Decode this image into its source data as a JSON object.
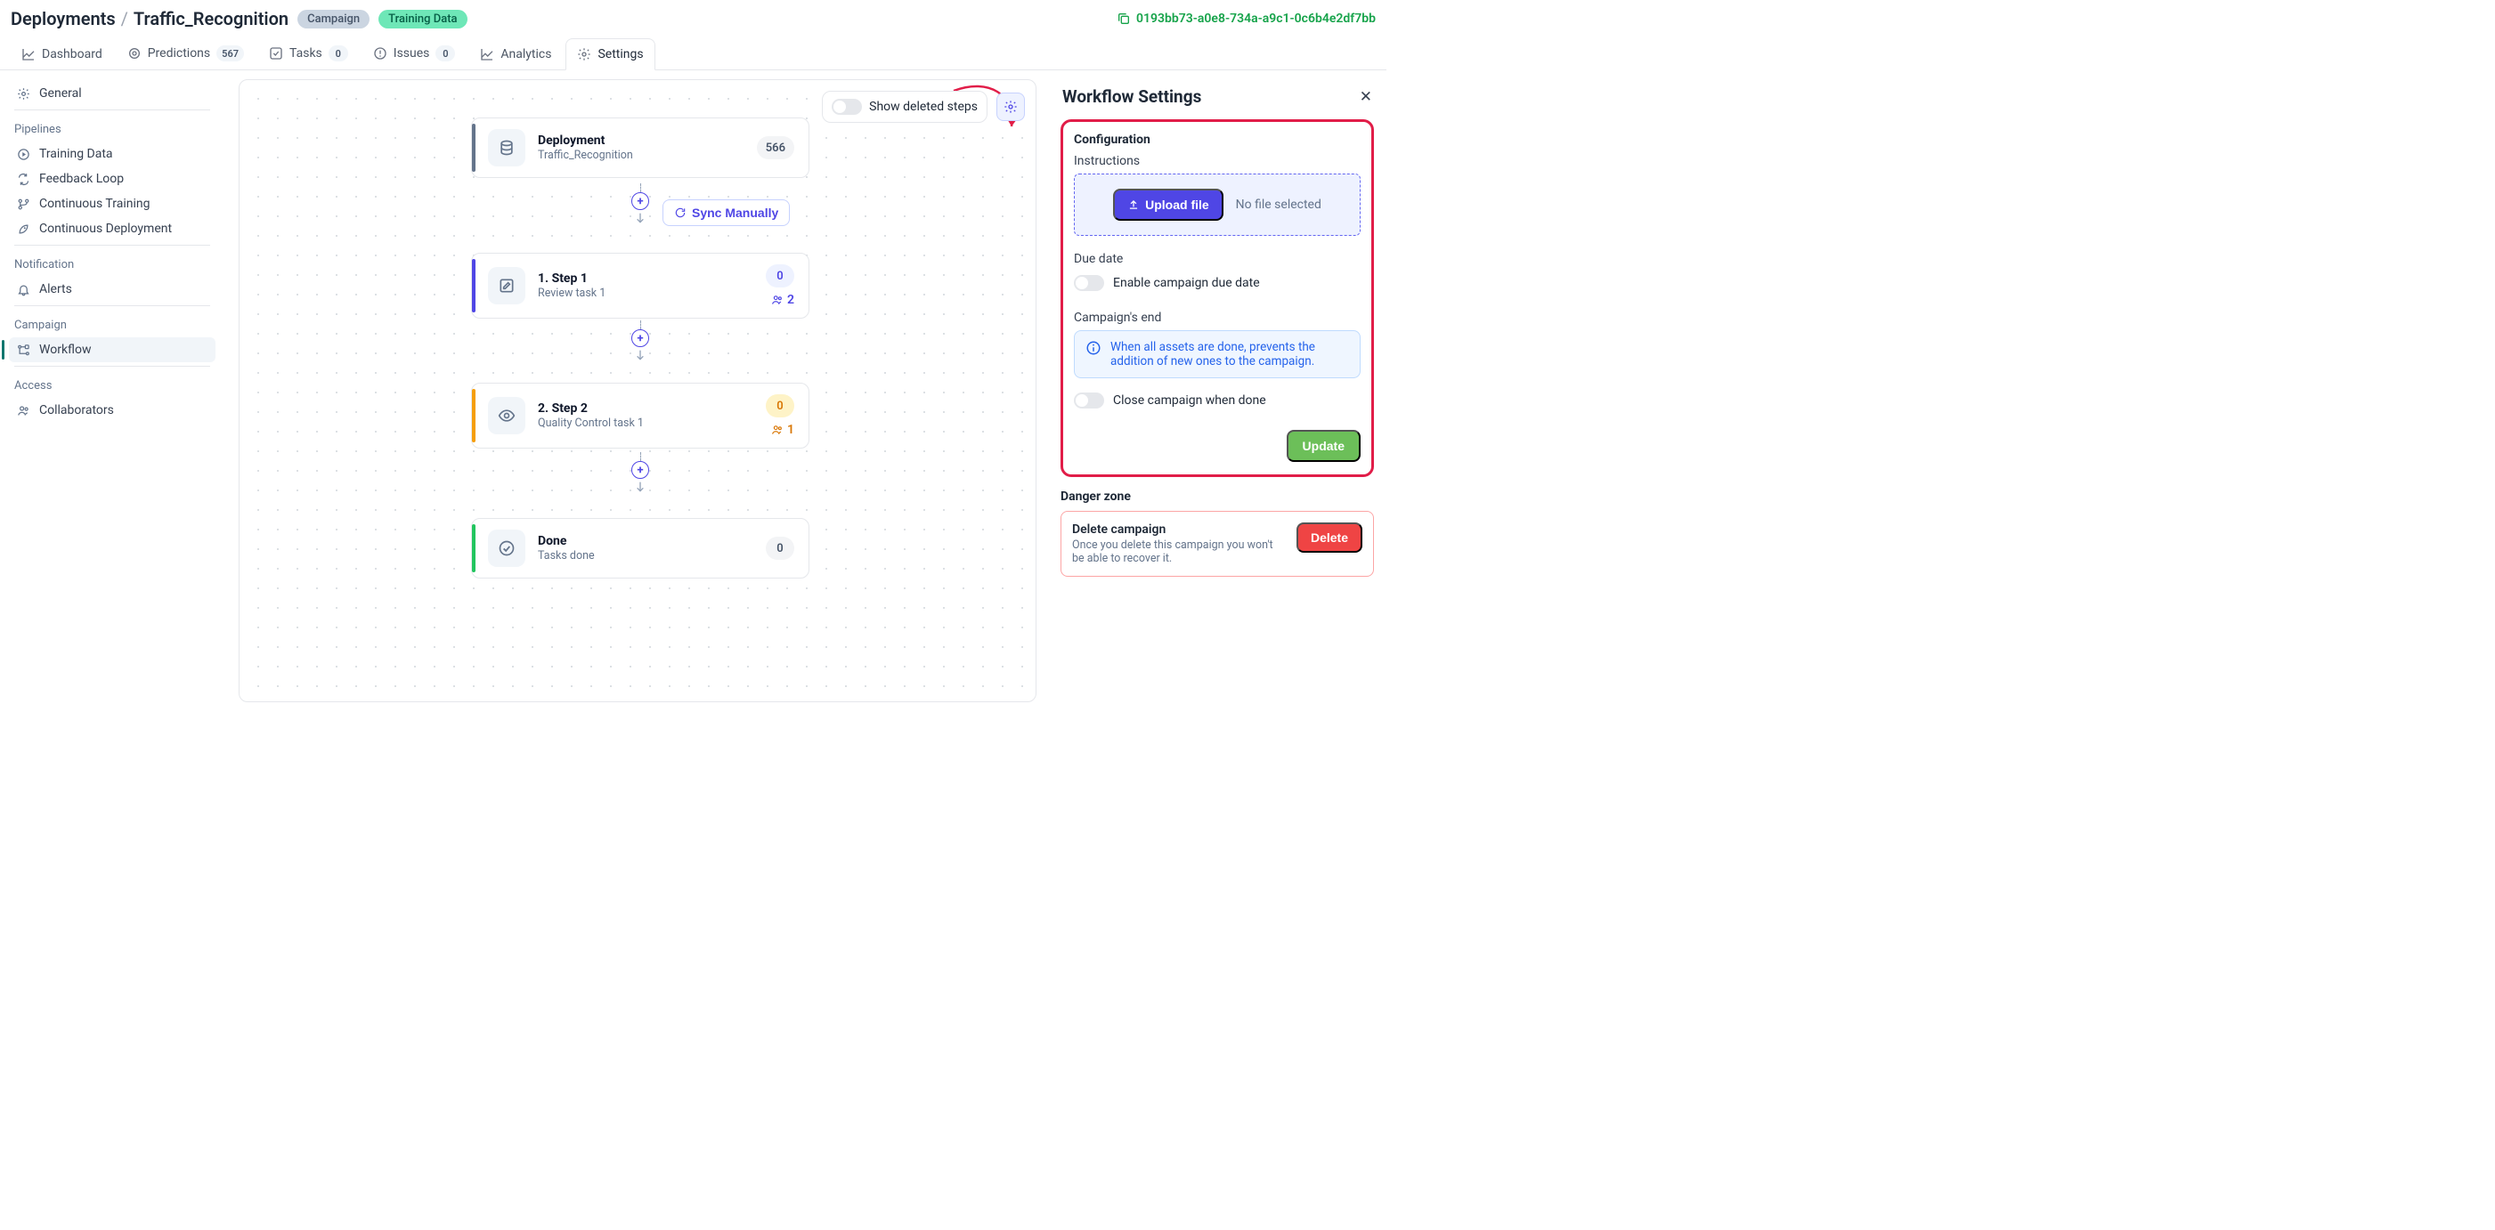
{
  "header": {
    "breadcrumb_root": "Deployments",
    "breadcrumb_current": "Traffic_Recognition",
    "tag_campaign": "Campaign",
    "tag_training": "Training Data",
    "copy_id": "0193bb73-a0e8-734a-a9c1-0c6b4e2df7bb"
  },
  "tabs": {
    "dashboard": "Dashboard",
    "predictions": "Predictions",
    "predictions_count": "567",
    "tasks": "Tasks",
    "tasks_count": "0",
    "issues": "Issues",
    "issues_count": "0",
    "analytics": "Analytics",
    "settings": "Settings"
  },
  "sidebar": {
    "general": "General",
    "grp_pipelines": "Pipelines",
    "training_data": "Training Data",
    "feedback_loop": "Feedback Loop",
    "cont_training": "Continuous Training",
    "cont_deploy": "Continuous Deployment",
    "grp_notification": "Notification",
    "alerts": "Alerts",
    "grp_campaign": "Campaign",
    "workflow": "Workflow",
    "grp_access": "Access",
    "collaborators": "Collaborators"
  },
  "canvas": {
    "show_deleted": "Show deleted steps",
    "sync_manually": "Sync Manually",
    "depl_title": "Deployment",
    "depl_sub": "Traffic_Recognition",
    "depl_count": "566",
    "s1_title": "1. Step 1",
    "s1_sub": "Review task 1",
    "s1_count": "0",
    "s1_people": "2",
    "s2_title": "2. Step 2",
    "s2_sub": "Quality Control task 1",
    "s2_count": "0",
    "s2_people": "1",
    "done_title": "Done",
    "done_sub": "Tasks done",
    "done_count": "0"
  },
  "panel": {
    "title": "Workflow Settings",
    "sec_config": "Configuration",
    "lbl_instructions": "Instructions",
    "upload": "Upload file",
    "nofile": "No file selected",
    "lbl_due": "Due date",
    "toggle_due": "Enable campaign due date",
    "lbl_end": "Campaign's end",
    "info_end": "When all assets are done, prevents the addition of new ones to the campaign.",
    "toggle_close": "Close campaign when done",
    "update": "Update",
    "sec_danger": "Danger zone",
    "del_title": "Delete campaign",
    "del_sub": "Once you delete this campaign you won't be able to recover it.",
    "del_btn": "Delete"
  }
}
